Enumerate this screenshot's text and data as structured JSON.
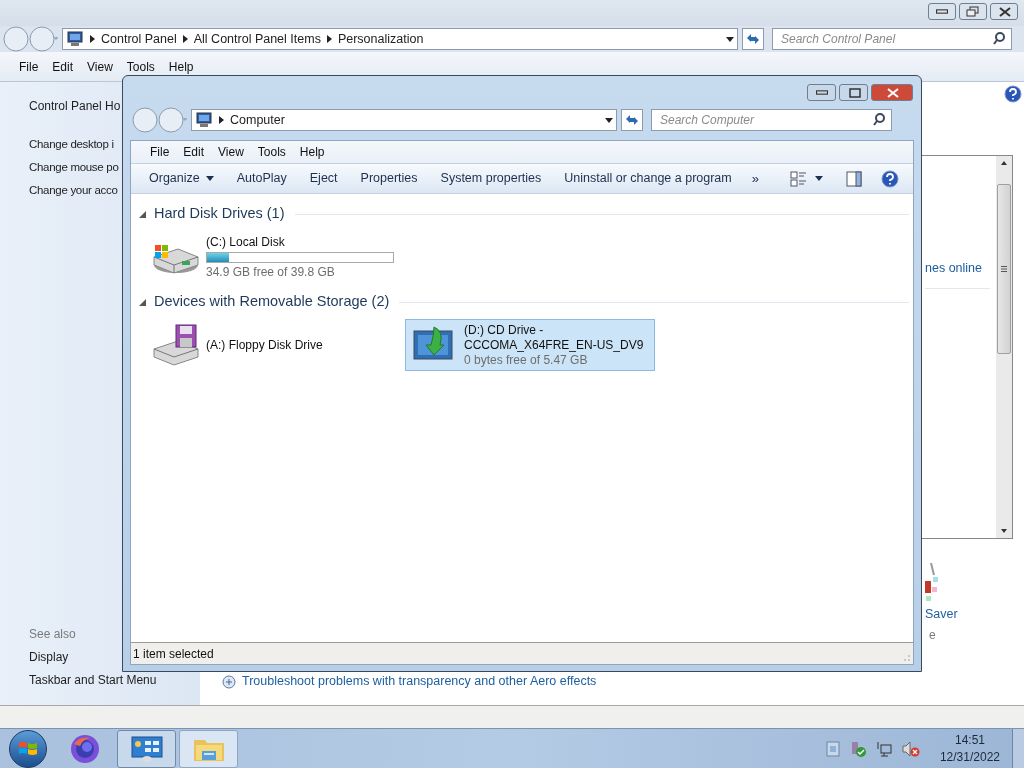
{
  "back_window": {
    "breadcrumb": [
      "Control Panel",
      "All Control Panel Items",
      "Personalization"
    ],
    "search": {
      "placeholder": "Search Control Panel"
    },
    "menu": [
      "File",
      "Edit",
      "View",
      "Tools",
      "Help"
    ],
    "sidebar": {
      "home": "Control Panel Ho",
      "tasks": [
        "Change desktop i",
        "Change mouse po",
        "Change your acco"
      ],
      "see_also": "See also",
      "links": [
        "Display",
        "Taskbar and Start Menu"
      ]
    },
    "content": {
      "list_text": "nes online",
      "item_label": "Saver",
      "item_sub": "e",
      "bottom_link": "Troubleshoot problems with transparency and other Aero effects"
    }
  },
  "front_window": {
    "breadcrumb": [
      "Computer"
    ],
    "search": {
      "placeholder": "Search Computer"
    },
    "menu": [
      "File",
      "Edit",
      "View",
      "Tools",
      "Help"
    ],
    "toolbar": [
      {
        "label": "Organize",
        "dropdown": true
      },
      {
        "label": "AutoPlay",
        "dropdown": false
      },
      {
        "label": "Eject",
        "dropdown": false
      },
      {
        "label": "Properties",
        "dropdown": false
      },
      {
        "label": "System properties",
        "dropdown": false
      },
      {
        "label": "Uninstall or change a program",
        "dropdown": false
      }
    ],
    "toolbar_overflow": "»",
    "groups": [
      {
        "title": "Hard Disk Drives (1)",
        "items": [
          {
            "kind": "disk",
            "name": "(C:) Local Disk",
            "level": 0.12,
            "detail": "34.9 GB free of 39.8 GB",
            "selected": false
          }
        ]
      },
      {
        "title": "Devices with Removable Storage (2)",
        "items": [
          {
            "kind": "floppy",
            "name": "(A:) Floppy Disk Drive",
            "selected": false
          },
          {
            "kind": "cd",
            "name": "(D:) CD Drive - CCCOMA_X64FRE_EN-US_DV9",
            "detail": "0 bytes free of 5.47 GB",
            "selected": true
          }
        ]
      }
    ],
    "status": "1 item selected"
  },
  "taskbar": {
    "time": "14:51",
    "date": "12/31/2022"
  }
}
